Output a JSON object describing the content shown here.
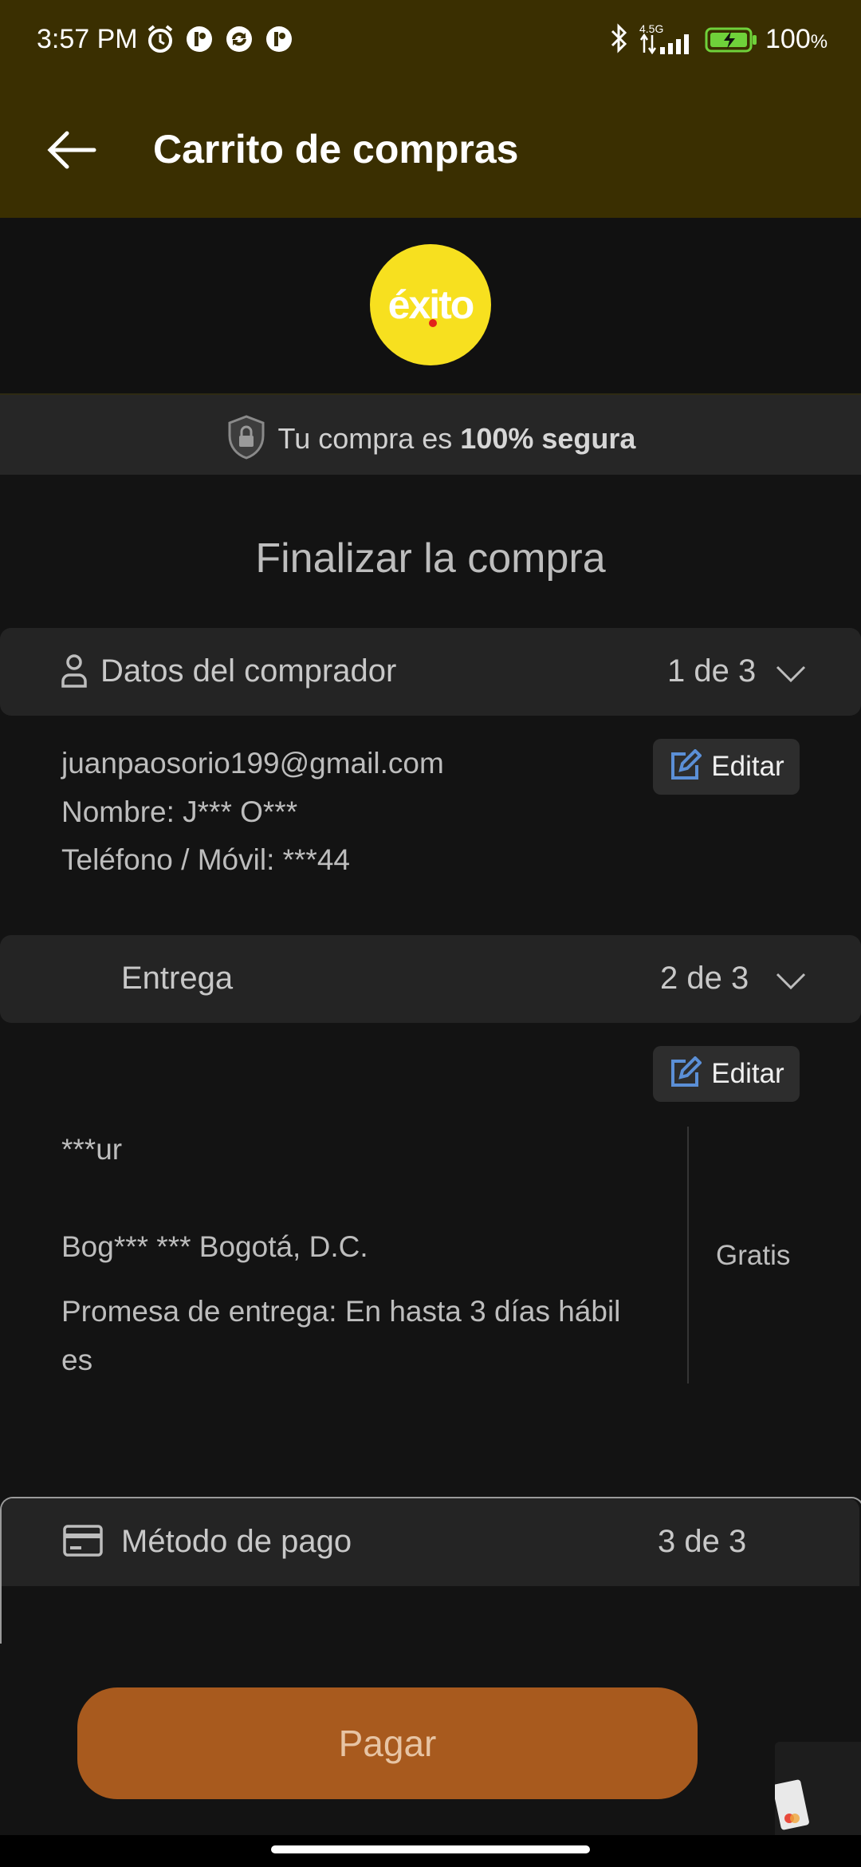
{
  "status_bar": {
    "time": "3:57 PM",
    "network": "4.5G",
    "battery": "100",
    "battery_unit": "%"
  },
  "app_bar": {
    "title": "Carrito de compras"
  },
  "logo": {
    "brand_text": "éxito",
    "bg_color": "#f7e01f"
  },
  "secure": {
    "prefix": "Tu compra es ",
    "strong": "100% segura"
  },
  "checkout_title": "Finalizar la compra",
  "buyer": {
    "label": "Datos del comprador",
    "step": "1 de 3",
    "email": "juanpaosorio199@gmail.com",
    "name_line": "Nombre: J*** O***",
    "phone_line": "Teléfono / Móvil: ***44",
    "edit_label": "Editar"
  },
  "delivery": {
    "label": "Entrega",
    "step": "2 de 3",
    "edit_label": "Editar",
    "address_line1": "***ur",
    "address_line2": "Bog*** *** Bogotá, D.C.",
    "promise_line1": "Promesa de entrega: En hasta 3 días hábil",
    "promise_line2": "es",
    "cost": "Gratis"
  },
  "payment": {
    "label": "Método de pago",
    "step": "3 de 3"
  },
  "pay_button": {
    "label": "Pagar",
    "color": "#a85a1e"
  },
  "icons": [
    "alarm-icon",
    "bluetooth-icon",
    "signal-icon",
    "battery-icon",
    "back-arrow-icon",
    "shield-lock-icon",
    "user-icon",
    "chevron-down-icon",
    "edit-icon",
    "credit-card-icon"
  ]
}
